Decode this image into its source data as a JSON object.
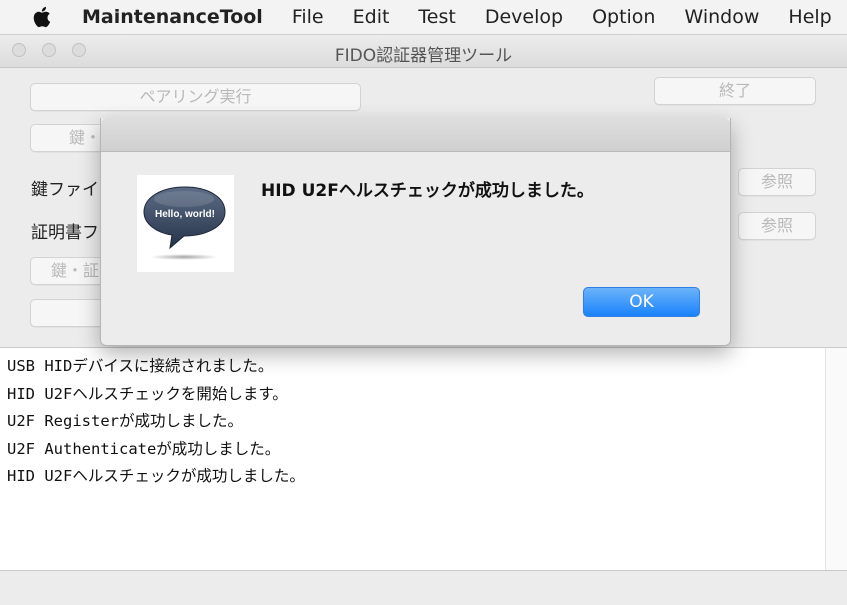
{
  "menubar": {
    "app_name": "MaintenanceTool",
    "items": [
      "File",
      "Edit",
      "Test",
      "Develop",
      "Option",
      "Window",
      "Help"
    ]
  },
  "window": {
    "title": "FIDO認証器管理ツール",
    "buttons": {
      "pairing": "ペアリング実行",
      "quit": "終了",
      "key_install": "鍵・",
      "browse_key": "参照",
      "browse_cert": "参照",
      "key_cert_delete": "鍵・証"
    },
    "labels": {
      "key_file": "鍵ファイ",
      "cert_file": "証明書フ"
    }
  },
  "log": {
    "lines": [
      "USB HIDデバイスに接続されました。",
      "HID U2Fヘルスチェックを開始します。",
      "U2F Registerが成功しました。",
      "U2F Authenticateが成功しました。",
      "HID U2Fヘルスチェックが成功しました。"
    ]
  },
  "alert": {
    "message": "HID U2Fヘルスチェックが成功しました。",
    "icon_text": "Hello, world!",
    "ok_label": "OK"
  },
  "colors": {
    "accent": "#1a82fb",
    "window_bg": "#ececec"
  }
}
